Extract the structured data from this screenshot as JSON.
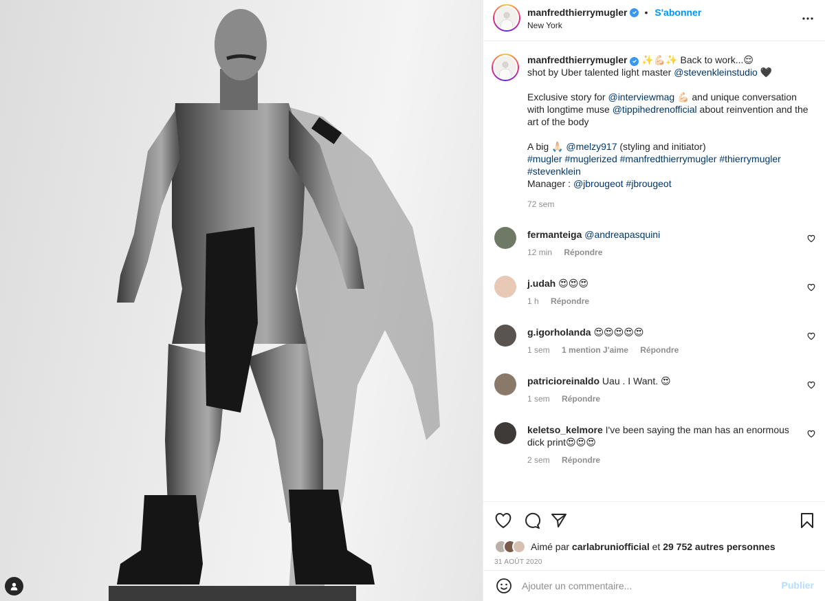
{
  "header": {
    "username": "manfredthierrymugler",
    "follow_label": "S'abonner",
    "location": "New York"
  },
  "caption": {
    "username": "manfredthierrymugler",
    "line1_a": " ✨💪🏻✨ Back to work...😌",
    "line1_b": "shot by Uber talented light master ",
    "mention_stevenklein": "@stevenkleinstudio",
    "heart": " 🖤",
    "p2_a": "Exclusive story for ",
    "mention_interview": "@interviewmag",
    "p2_b": " 💪🏻 and unique conversation with longtime muse ",
    "mention_tippi": "@tippihedrenofficial",
    "p2_c": " about reinvention and the art of the body",
    "p3_a": "A big 🙏🏻 ",
    "mention_melzy": "@melzy917",
    "p3_b": " (styling and initiator)",
    "hashtags": "#mugler #muglerized #manfredthierrymugler #thierrymugler #stevenklein",
    "manager_label": "Manager : ",
    "mention_jbrougeot": "@jbrougeot",
    "hashtag_jbrougeot": " #jbrougeot",
    "time": "72 sem"
  },
  "comments": [
    {
      "username": "fermanteiga",
      "text": "@andreapasquini",
      "is_mention": true,
      "time": "12 min",
      "mentions": "",
      "reply": "Répondre",
      "avatar_color": "#6f7a66"
    },
    {
      "username": "j.udah",
      "text": "😍😍😍",
      "is_mention": false,
      "time": "1 h",
      "mentions": "",
      "reply": "Répondre",
      "avatar_color": "#e8c9b5"
    },
    {
      "username": "g.igorholanda",
      "text": "😍😍😍😍😍",
      "is_mention": false,
      "time": "1 sem",
      "mentions": "1 mention J'aime",
      "reply": "Répondre",
      "avatar_color": "#5a5350"
    },
    {
      "username": "patricioreinaldo",
      "text": "Uau . I Want. 😍",
      "is_mention": false,
      "time": "1 sem",
      "mentions": "",
      "reply": "Répondre",
      "avatar_color": "#8a7868"
    },
    {
      "username": "keletso_kelmore",
      "text": "I've been saying the man has an enormous dick print😍😍😍",
      "is_mention": false,
      "time": "2 sem",
      "mentions": "",
      "reply": "Répondre",
      "avatar_color": "#3e3a38"
    }
  ],
  "likes": {
    "prefix": "Aimé par ",
    "user": "carlabrunio​fficial",
    "middle": " et ",
    "others": "29 752 autres personnes"
  },
  "date": "31 AOÛT 2020",
  "footer": {
    "placeholder": "Ajouter un commentaire...",
    "publish_label": "Publier"
  },
  "colors": {
    "accent": "#0095f6",
    "link": "#00376b",
    "muted": "#8e8e8e",
    "border": "#efefef"
  }
}
